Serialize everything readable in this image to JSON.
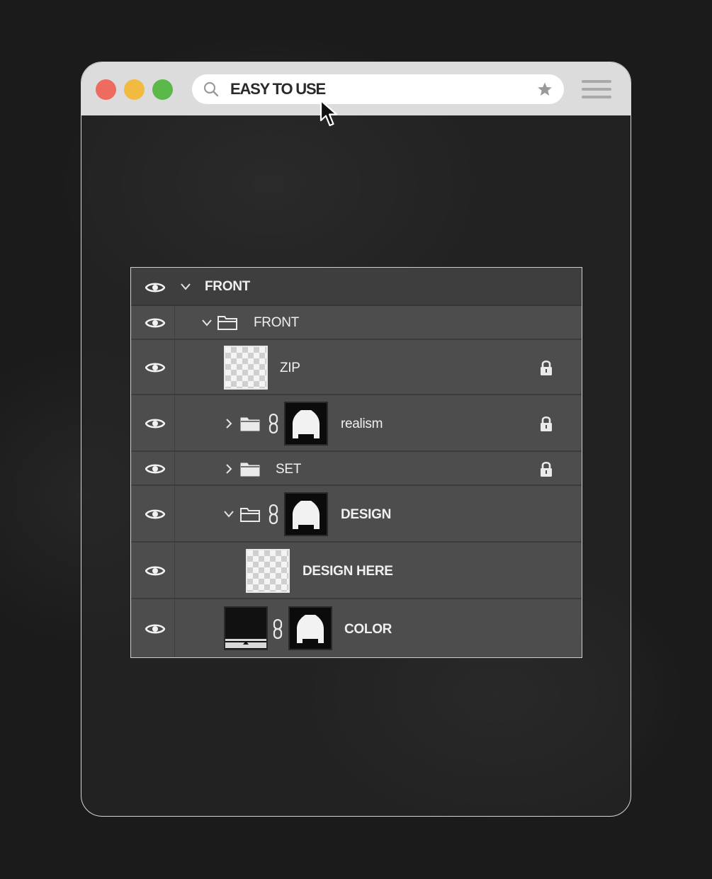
{
  "browser": {
    "url_text": "EASY TO USE",
    "icons": {
      "search": "search-icon",
      "bookmark": "star-icon",
      "menu": "hamburger-menu-icon",
      "cursor": "mouse-pointer-icon"
    },
    "traffic_lights": {
      "close": "#ee6b5f",
      "minimize": "#f2bb3f",
      "maximize": "#5ab948"
    }
  },
  "layers_panel": {
    "rows": [
      {
        "label": "FRONT",
        "kind": "group-header",
        "expanded": true,
        "visible": true
      },
      {
        "label": "FRONT",
        "kind": "folder",
        "expanded": true,
        "visible": true
      },
      {
        "label": "ZIP",
        "kind": "layer",
        "locked": true,
        "visible": true
      },
      {
        "label": "realism",
        "kind": "folder-with-mask",
        "expanded": false,
        "locked": true,
        "visible": true
      },
      {
        "label": "SET",
        "kind": "folder",
        "expanded": false,
        "locked": true,
        "visible": true
      },
      {
        "label": "DESIGN",
        "kind": "folder-with-mask",
        "expanded": true,
        "visible": true
      },
      {
        "label": "DESIGN HERE",
        "kind": "layer",
        "visible": true
      },
      {
        "label": "COLOR",
        "kind": "fill-layer-with-mask",
        "visible": true
      }
    ]
  }
}
